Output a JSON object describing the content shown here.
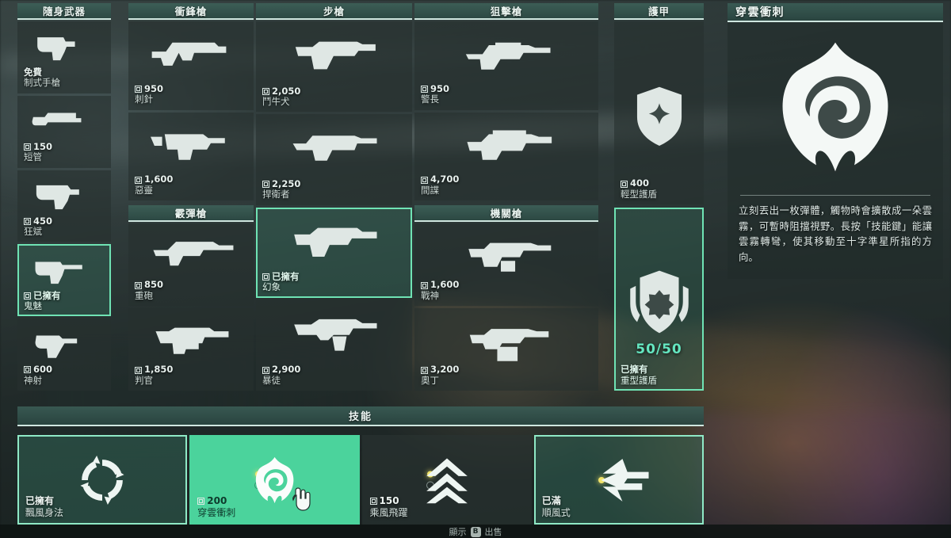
{
  "columns": [
    {
      "id": "sidearms",
      "header": "隨身武器",
      "items": [
        {
          "price": "免費",
          "free": true,
          "name": "制式手槍",
          "icon": "pistol-classic",
          "state": "buyable"
        },
        {
          "price": "150",
          "name": "短管",
          "icon": "shotgun-shorty",
          "state": "buyable"
        },
        {
          "price": "450",
          "name": "狂斌",
          "icon": "pistol-frenzy",
          "state": "buyable"
        },
        {
          "price": "已擁有",
          "name": "鬼魅",
          "icon": "pistol-ghost",
          "state": "owned"
        },
        {
          "price": "600",
          "name": "神射",
          "icon": "revolver-sheriff",
          "state": "buyable"
        }
      ]
    },
    {
      "id": "smgs",
      "header": "衝鋒槍",
      "items": [
        {
          "price": "950",
          "name": "刺針",
          "icon": "smg-stinger",
          "state": "buyable"
        },
        {
          "price": "1,600",
          "name": "惡靈",
          "icon": "smg-spectre",
          "state": "buyable"
        }
      ]
    },
    {
      "id": "shotguns",
      "header": "霰彈槍",
      "items": [
        {
          "price": "850",
          "name": "重砲",
          "icon": "shotgun-bucky",
          "state": "buyable"
        },
        {
          "price": "1,850",
          "name": "判官",
          "icon": "shotgun-judge",
          "state": "buyable"
        }
      ]
    },
    {
      "id": "rifles",
      "header": "步槍",
      "items": [
        {
          "price": "2,050",
          "name": "鬥牛犬",
          "icon": "rifle-bulldog",
          "state": "buyable"
        },
        {
          "price": "2,250",
          "name": "捍衛者",
          "icon": "rifle-guardian",
          "state": "buyable"
        },
        {
          "price": "已擁有",
          "name": "幻象",
          "icon": "rifle-phantom",
          "state": "owned"
        },
        {
          "price": "2,900",
          "name": "暴徒",
          "icon": "rifle-vandal",
          "state": "buyable"
        }
      ]
    },
    {
      "id": "snipers",
      "header": "狙擊槍",
      "items": [
        {
          "price": "950",
          "name": "警長",
          "icon": "sniper-marshal",
          "state": "buyable"
        },
        {
          "price": "4,700",
          "name": "間諜",
          "icon": "sniper-operator",
          "state": "buyable"
        }
      ]
    },
    {
      "id": "machineguns",
      "header": "機關槍",
      "items": [
        {
          "price": "1,600",
          "name": "戰神",
          "icon": "lmg-ares",
          "state": "buyable"
        },
        {
          "price": "3,200",
          "name": "奧丁",
          "icon": "lmg-odin",
          "state": "buyable"
        }
      ]
    }
  ],
  "armor": {
    "header": "護甲",
    "items": [
      {
        "price": "400",
        "name": "輕型護盾",
        "icon": "light-shield-icon",
        "state": "buyable",
        "hp": ""
      },
      {
        "price": "已擁有",
        "name": "重型護盾",
        "icon": "heavy-shield-icon",
        "state": "owned",
        "hp": "50/50"
      }
    ]
  },
  "detail": {
    "title": "穿雲衝刺",
    "icon": "cloudburst-icon",
    "description": "立刻丟出一枚彈體，觸物時會擴散成一朵雲霧，可暫時阻擋視野。長按「技能鍵」能讓雲霧轉彎，使其移動至十字準星所指的方向。"
  },
  "skills": {
    "header": "技能",
    "items": [
      {
        "price": "已擁有",
        "name": "飄風身法",
        "icon": "tailwind-icon",
        "state": "owned",
        "charges": []
      },
      {
        "price": "200",
        "name": "穿雲衝刺",
        "icon": "cloudburst-icon",
        "state": "active",
        "charges": [
          "on",
          "off"
        ]
      },
      {
        "price": "150",
        "name": "乘風飛躍",
        "icon": "updraft-icon",
        "state": "buyable",
        "charges": [
          "on",
          "off"
        ]
      },
      {
        "price": "已滿",
        "name": "順風式",
        "icon": "bladestorm-icon",
        "state": "ultimate-full",
        "charges": [
          "on"
        ]
      }
    ]
  },
  "footer": {
    "hint_before": "顯示",
    "hint_key": "B",
    "hint_after": "出售"
  },
  "colors": {
    "accent_green": "#4bd39c",
    "border_green": "#6fe3b4",
    "header_green": "#3d6058",
    "hp_teal": "#64e6c0",
    "charge_yellow": "#f2e46a"
  }
}
